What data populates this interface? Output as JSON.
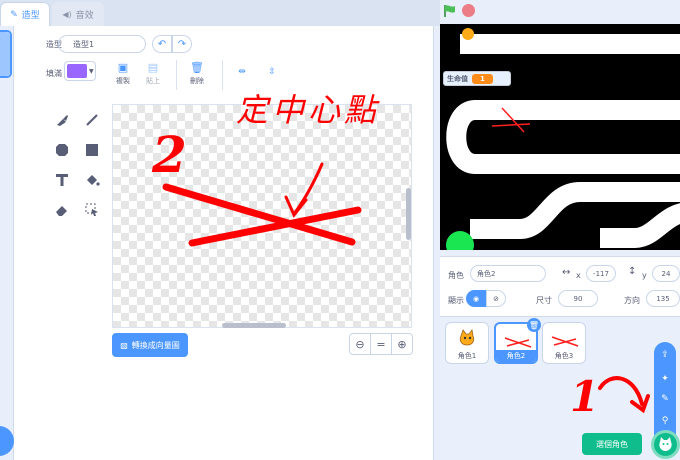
{
  "tabs": {
    "costumes": "造型",
    "sounds": "音效"
  },
  "editor": {
    "costume_label": "造型",
    "costume_name": "造型1",
    "fill_label": "填滿",
    "fill_color": "#9966ff",
    "copy_label": "複製",
    "paste_label": "貼上",
    "delete_label": "刪除",
    "convert_button": "轉換成向量圖",
    "zoom_reset": "="
  },
  "annotations": {
    "title": "定中心點",
    "number": "2",
    "bottom_number": "1"
  },
  "stage": {
    "lives_label": "生命值",
    "lives_value": "1"
  },
  "sprite_info": {
    "sprite_label": "角色",
    "sprite_name": "角色2",
    "x_label": "x",
    "x_value": "-117",
    "y_label": "y",
    "y_value": "24",
    "show_label": "顯示",
    "size_label": "尺寸",
    "size_value": "90",
    "direction_label": "方向",
    "direction_value": "135"
  },
  "sprites": [
    {
      "name": "角色1"
    },
    {
      "name": "角色2"
    },
    {
      "name": "角色3"
    }
  ],
  "tooltip": "選個角色",
  "colors": {
    "accent": "#4c97ff",
    "annotation": "#ff0000",
    "add_sprite": "#0fbd8c"
  }
}
